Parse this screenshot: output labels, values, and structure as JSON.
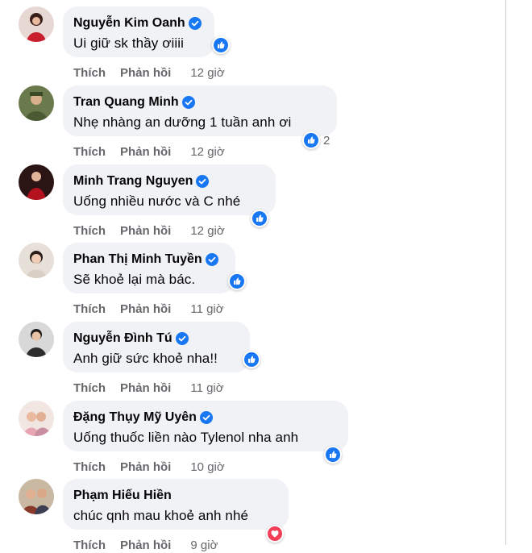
{
  "actions": {
    "like": "Thích",
    "reply": "Phản hồi"
  },
  "colors": {
    "accent": "#1877f2",
    "bubble": "#f0f2f5",
    "meta": "#65676b",
    "love": "#f33e58"
  },
  "comments": [
    {
      "name": "Nguyễn Kim Oanh",
      "verified": true,
      "text": "Ui giữ sk thầy ơiiii",
      "time": "12 giờ",
      "reaction": "like-icon",
      "reaction_count": ""
    },
    {
      "name": "Tran Quang Minh",
      "verified": true,
      "text": "Nhẹ nhàng an dưỡng 1 tuần anh ơi",
      "time": "12 giờ",
      "reaction": "like-icon",
      "reaction_count": "2"
    },
    {
      "name": "Minh Trang Nguyen",
      "verified": true,
      "text": "Uống nhiều nước và C nhé",
      "time": "12 giờ",
      "reaction": "like-icon",
      "reaction_count": ""
    },
    {
      "name": "Phan Thị Minh Tuyền",
      "verified": true,
      "text": "Sẽ khoẻ lại mà bác.",
      "time": "11 giờ",
      "reaction": "like-icon",
      "reaction_count": ""
    },
    {
      "name": "Nguyễn Đình Tú",
      "verified": true,
      "text": "Anh giữ sức khoẻ nha!!",
      "time": "11 giờ",
      "reaction": "like-icon",
      "reaction_count": ""
    },
    {
      "name": "Đặng Thụy Mỹ Uyên",
      "verified": true,
      "text": "Uống thuốc liền nào Tylenol nha anh",
      "time": "10 giờ",
      "reaction": "like-icon",
      "reaction_count": ""
    },
    {
      "name": "Phạm Hiếu Hiền",
      "verified": false,
      "text": "chúc qnh mau khoẻ anh nhé",
      "time": "9 giờ",
      "reaction": "love-icon",
      "reaction_count": ""
    }
  ]
}
